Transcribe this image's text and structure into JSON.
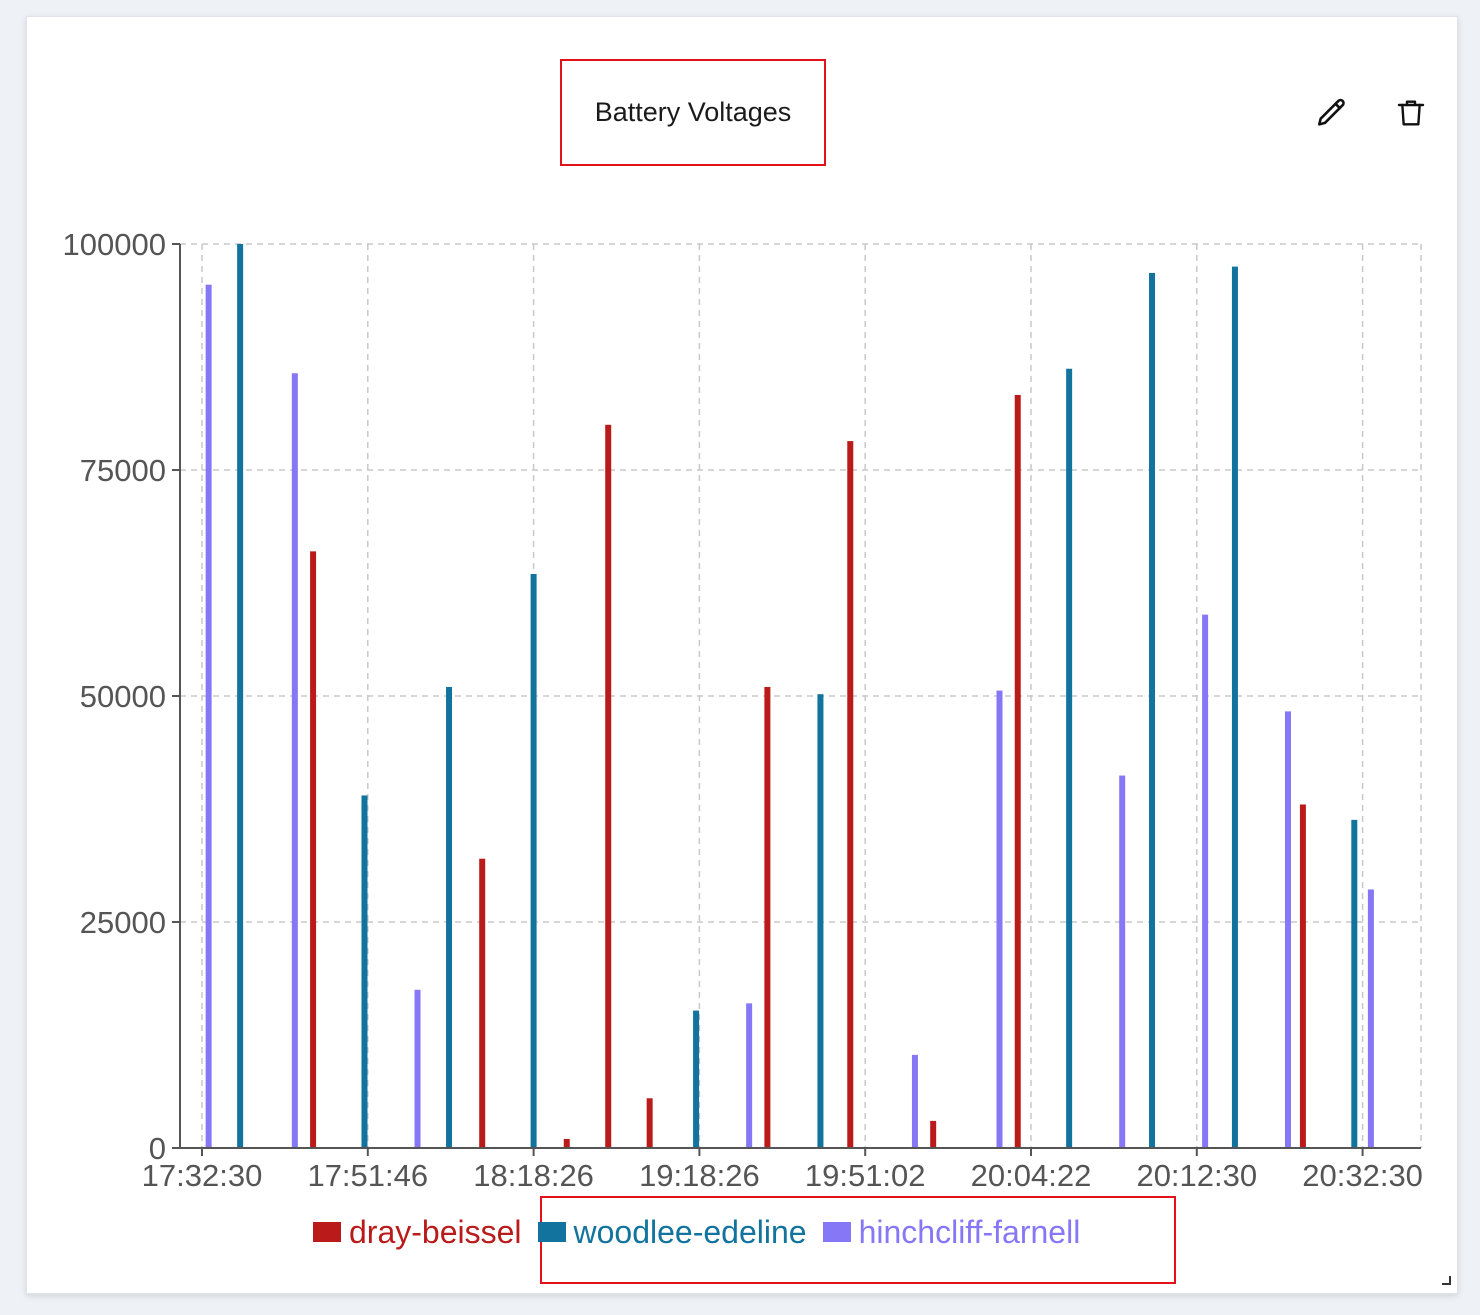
{
  "widget": {
    "title": "Battery Voltages",
    "edit_icon": "pencil-icon",
    "delete_icon": "trash-icon"
  },
  "colors": {
    "dray-beissel": "#bb1a1a",
    "woodlee-edeline": "#11739e",
    "hinchcliff-farnell": "#8577f6",
    "highlight": "#e3121a",
    "grid": "#c8c8c8",
    "axis": "#555555"
  },
  "legend": {
    "items": [
      {
        "label": "dray-beissel",
        "color": "#bb1a1a"
      },
      {
        "label": "woodlee-edeline",
        "color": "#11739e"
      },
      {
        "label": "hinchcliff-farnell",
        "color": "#8577f6"
      }
    ]
  },
  "chart_data": {
    "type": "bar",
    "title": "Battery Voltages",
    "xlabel": "",
    "ylabel": "",
    "ylim": [
      0,
      100000
    ],
    "yticks": [
      0,
      25000,
      50000,
      75000,
      100000
    ],
    "xticks": [
      "17:32:30",
      "17:51:46",
      "18:18:26",
      "19:18:26",
      "19:51:02",
      "20:04:22",
      "20:12:30",
      "20:32:30"
    ],
    "grid": true,
    "legend_position": "bottom",
    "points": [
      {
        "series": "hinchcliff-farnell",
        "x": 0.04,
        "value": 95500
      },
      {
        "series": "woodlee-edeline",
        "x": 0.23,
        "value": 100000
      },
      {
        "series": "hinchcliff-farnell",
        "x": 0.56,
        "value": 85700
      },
      {
        "series": "dray-beissel",
        "x": 0.67,
        "value": 66000
      },
      {
        "series": "woodlee-edeline",
        "x": 0.98,
        "value": 39000
      },
      {
        "series": "hinchcliff-farnell",
        "x": 1.3,
        "value": 17500
      },
      {
        "series": "woodlee-edeline",
        "x": 1.49,
        "value": 51000
      },
      {
        "series": "dray-beissel",
        "x": 1.69,
        "value": 32000
      },
      {
        "series": "woodlee-edeline",
        "x": 2.0,
        "value": 63500
      },
      {
        "series": "dray-beissel",
        "x": 2.2,
        "value": 1000
      },
      {
        "series": "dray-beissel",
        "x": 2.45,
        "value": 80000
      },
      {
        "series": "dray-beissel",
        "x": 2.7,
        "value": 5500
      },
      {
        "series": "woodlee-edeline",
        "x": 2.98,
        "value": 15200
      },
      {
        "series": "hinchcliff-farnell",
        "x": 3.3,
        "value": 16000
      },
      {
        "series": "dray-beissel",
        "x": 3.41,
        "value": 51000
      },
      {
        "series": "woodlee-edeline",
        "x": 3.73,
        "value": 50200
      },
      {
        "series": "dray-beissel",
        "x": 3.91,
        "value": 78200
      },
      {
        "series": "hinchcliff-farnell",
        "x": 4.3,
        "value": 10300
      },
      {
        "series": "dray-beissel",
        "x": 4.41,
        "value": 3000
      },
      {
        "series": "hinchcliff-farnell",
        "x": 4.81,
        "value": 50600
      },
      {
        "series": "dray-beissel",
        "x": 4.92,
        "value": 83300
      },
      {
        "series": "woodlee-edeline",
        "x": 5.23,
        "value": 86200
      },
      {
        "series": "hinchcliff-farnell",
        "x": 5.55,
        "value": 41200
      },
      {
        "series": "woodlee-edeline",
        "x": 5.73,
        "value": 96800
      },
      {
        "series": "hinchcliff-farnell",
        "x": 6.05,
        "value": 59000
      },
      {
        "series": "woodlee-edeline",
        "x": 6.23,
        "value": 97500
      },
      {
        "series": "hinchcliff-farnell",
        "x": 6.55,
        "value": 48300
      },
      {
        "series": "dray-beissel",
        "x": 6.64,
        "value": 38000
      },
      {
        "series": "woodlee-edeline",
        "x": 6.95,
        "value": 36300
      },
      {
        "series": "hinchcliff-farnell",
        "x": 7.05,
        "value": 28600
      }
    ]
  }
}
